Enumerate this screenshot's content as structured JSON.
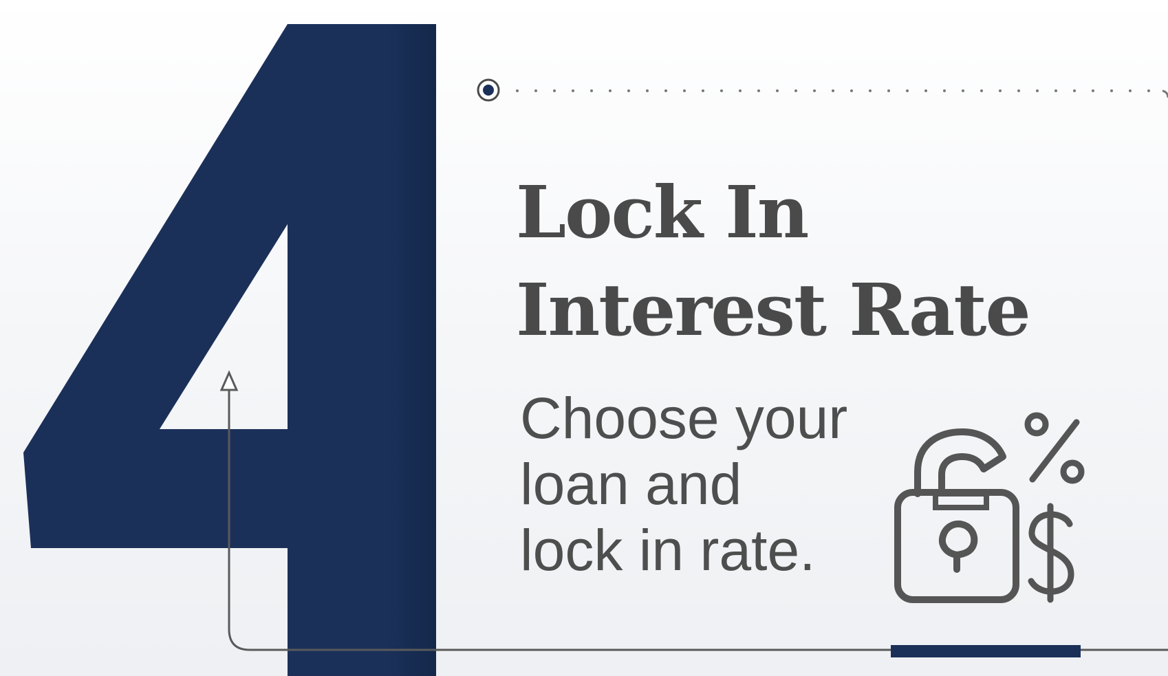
{
  "step": {
    "number": "4",
    "title_lines": [
      "Lock In",
      "Interest Rate"
    ],
    "description_lines": [
      "Choose your",
      "loan and",
      "lock in rate."
    ]
  },
  "icons": {
    "lock": "open-padlock-icon",
    "percent": "percent-icon",
    "dollar": "dollar-icon"
  },
  "colors": {
    "navy": "#1b3059",
    "text": "#4a4a4a",
    "line": "#5a5a5a",
    "icon": "#555555"
  }
}
